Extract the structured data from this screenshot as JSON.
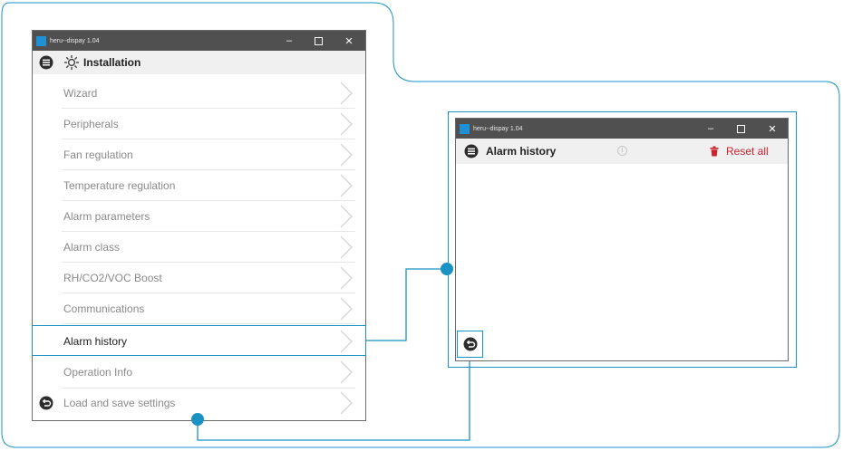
{
  "left_window": {
    "title": "heru--dispay 1.04",
    "minimize": "–",
    "maximize": "☐",
    "close": "✕",
    "header_title": "Installation",
    "items": [
      {
        "label": "Wizard"
      },
      {
        "label": "Peripherals"
      },
      {
        "label": "Fan regulation"
      },
      {
        "label": "Temperature regulation"
      },
      {
        "label": "Alarm parameters"
      },
      {
        "label": "Alarm class"
      },
      {
        "label": "RH/CO2/VOC Boost"
      },
      {
        "label": "Communications"
      },
      {
        "label": "Alarm history"
      },
      {
        "label": "Operation Info"
      },
      {
        "label": "Load and save settings"
      }
    ],
    "selected_item": "Alarm history"
  },
  "right_window": {
    "title": "heru--dispay 1.04",
    "minimize": "–",
    "maximize": "☐",
    "close": "✕",
    "header_title": "Alarm history",
    "info_icon": "i",
    "reset_label": "Reset all"
  },
  "colors": {
    "accent": "#1a92c4",
    "titlebar": "#505050",
    "header_bg": "#f0f0f0",
    "reset_red": "#d0202a",
    "item_text": "#8a8a8a"
  }
}
